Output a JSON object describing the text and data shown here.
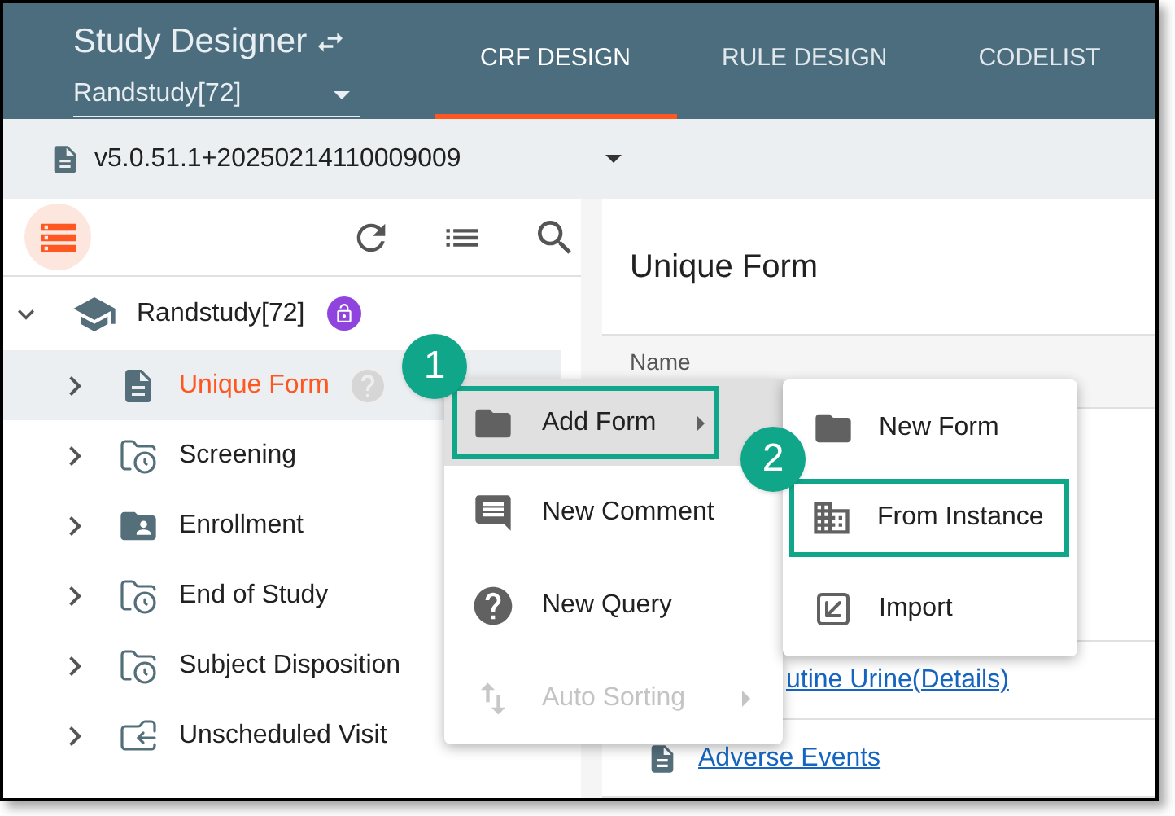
{
  "app": {
    "title": "Study Designer",
    "study_select": {
      "value": "Randstudy[72]"
    }
  },
  "tabs": [
    {
      "label": "CRF DESIGN",
      "selected": true
    },
    {
      "label": "RULE DESIGN",
      "selected": false
    },
    {
      "label": "CODELIST",
      "selected": false
    }
  ],
  "version_select": {
    "value": "v5.0.51.1+20250214110009009"
  },
  "tree": {
    "label": "Randstudy[72]",
    "expanded": true,
    "locked": false,
    "children": [
      {
        "label": "Unique Form",
        "kind": "form",
        "selected": true,
        "expanded": false
      },
      {
        "label": "Screening",
        "kind": "visit",
        "selected": false,
        "expanded": false
      },
      {
        "label": "Enrollment",
        "kind": "shared",
        "selected": false,
        "expanded": false
      },
      {
        "label": "End of Study",
        "kind": "visit",
        "selected": false,
        "expanded": false
      },
      {
        "label": "Subject Disposition",
        "kind": "visit",
        "selected": false,
        "expanded": false
      },
      {
        "label": "Unscheduled Visit",
        "kind": "unscheduled",
        "selected": false,
        "expanded": false
      }
    ]
  },
  "detail": {
    "title": "Unique Form",
    "table": {
      "columns": [
        "Name"
      ],
      "rows": [
        {
          "name": "utine Urine(Details)",
          "kind": "link"
        },
        {
          "name": "Adverse Events",
          "kind": "form"
        }
      ]
    }
  },
  "context_menu": [
    {
      "label": "Add Form",
      "kind": "folder",
      "selected": true,
      "disabled": false,
      "submenu": true,
      "callout": "1"
    },
    {
      "label": "New Comment",
      "kind": "comment",
      "selected": false,
      "disabled": false,
      "submenu": false
    },
    {
      "label": "New Query",
      "kind": "help",
      "selected": false,
      "disabled": false,
      "submenu": false
    },
    {
      "label": "Auto Sorting",
      "kind": "sort",
      "selected": false,
      "disabled": true,
      "submenu": true
    }
  ],
  "submenu": [
    {
      "label": "New Form",
      "kind": "folder"
    },
    {
      "label": "From Instance",
      "kind": "building",
      "callout": "2"
    },
    {
      "label": "Import",
      "kind": "import"
    }
  ]
}
